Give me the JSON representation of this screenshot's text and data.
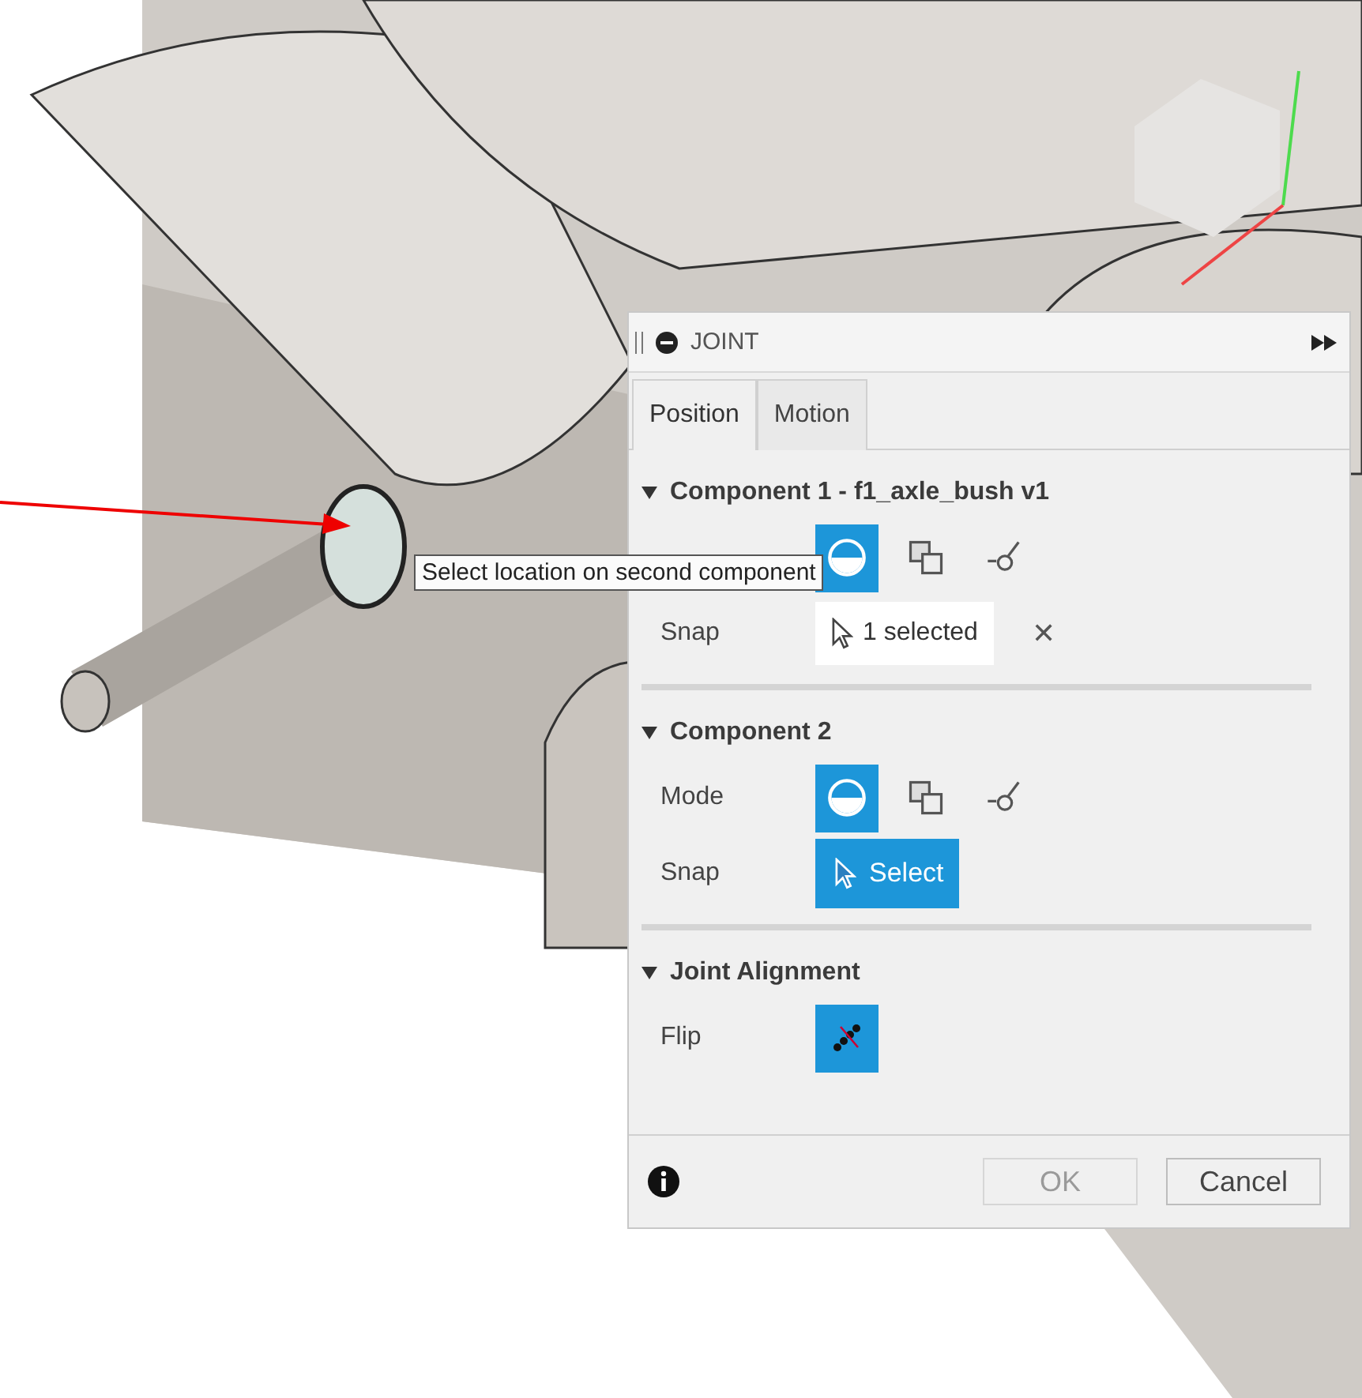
{
  "panel": {
    "title": "JOINT",
    "tabs": [
      {
        "label": "Position",
        "selected": true
      },
      {
        "label": "Motion",
        "selected": false
      }
    ],
    "sections": [
      {
        "title": "Component 1 - f1_axle_bush v1",
        "expanded": true,
        "rows": [
          {
            "kind": "mode",
            "options": [
              {
                "kind": "simple",
                "selected": true
              },
              {
                "kind": "between",
                "selected": false
              },
              {
                "kind": "two-faces",
                "selected": false
              }
            ]
          },
          {
            "kind": "selection",
            "label": "Snap",
            "value": "1 selected",
            "clear": "✕"
          }
        ]
      },
      {
        "title": "Component 2",
        "expanded": true,
        "rows": [
          {
            "kind": "mode",
            "label": "Mode",
            "options": [
              {
                "kind": "simple",
                "selected": true
              },
              {
                "kind": "between",
                "selected": false
              },
              {
                "kind": "two-faces",
                "selected": false
              }
            ]
          },
          {
            "kind": "select",
            "label": "Snap",
            "value": "Select"
          }
        ]
      },
      {
        "title": "Joint Alignment",
        "expanded": true,
        "rows": [
          {
            "kind": "toggle",
            "label": "Flip",
            "on": true
          }
        ]
      }
    ],
    "footer": {
      "ok": {
        "label": "OK",
        "disabled": true
      },
      "cancel": {
        "label": "Cancel",
        "disabled": false
      }
    }
  },
  "tooltip": "Select location on second component"
}
